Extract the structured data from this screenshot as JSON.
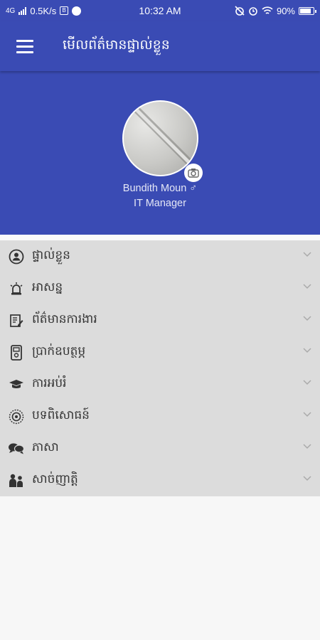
{
  "status_bar": {
    "network": "4G",
    "speed": "0.5K/s",
    "time": "10:32 AM",
    "battery": "90%",
    "battery_level": 0.9
  },
  "app_bar": {
    "title": "មើលព័ត៌មានផ្ទាល់ខ្លួន",
    "menu_icon": "hamburger-icon"
  },
  "profile": {
    "name": "Bundith Moun ♂",
    "job_title": "IT Manager",
    "camera_icon": "camera-icon"
  },
  "menu": {
    "items": [
      {
        "label": "ផ្ទាល់ខ្លួន",
        "icon": "person-icon"
      },
      {
        "label": "អាសន្ន",
        "icon": "siren-icon"
      },
      {
        "label": "ព័ត៌មានការងារ",
        "icon": "edit-document-icon"
      },
      {
        "label": "ប្រាក់ឧបត្ថម្ភ",
        "icon": "money-icon"
      },
      {
        "label": "ការអប់រំ",
        "icon": "graduation-cap-icon"
      },
      {
        "label": "បទពិសោធន៍",
        "icon": "experience-icon"
      },
      {
        "label": "ភាសា",
        "icon": "chat-bubbles-icon"
      },
      {
        "label": "សាច់ញាត្តិ",
        "icon": "family-icon"
      }
    ]
  }
}
